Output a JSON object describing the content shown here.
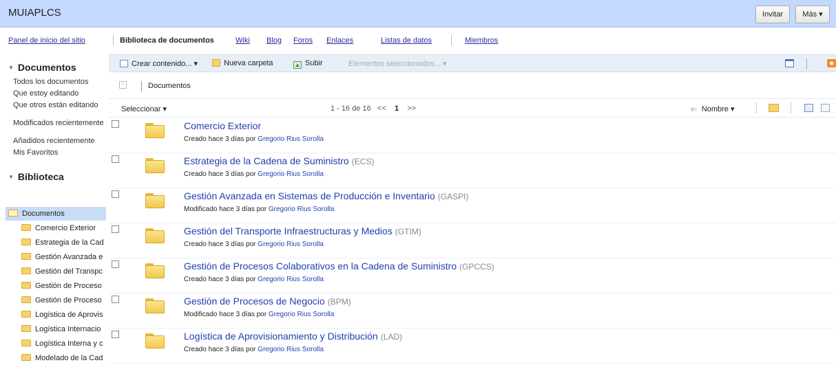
{
  "site": {
    "title": "MUIAPLCS",
    "invite_label": "Invitar",
    "more_label": "Más ▾"
  },
  "nav": {
    "home": "Panel de inicio del sitio",
    "active": "Biblioteca de documentos",
    "links": [
      "Wiki",
      "Blog",
      "Foros",
      "Enlaces",
      "Listas de datos"
    ],
    "members": "Miembros"
  },
  "sidebar": {
    "documents_heading": "Documentos",
    "document_links": [
      "Todos los documentos",
      "Que estoy editando",
      "Que otros están editando",
      "Modificados recientemente",
      "Añadidos recientemente",
      "Mis Favoritos"
    ],
    "library_heading": "Biblioteca",
    "tree_root": "Documentos",
    "tree_items": [
      "Comercio Exterior",
      "Estrategia de la Cad",
      "Gestión Avanzada e",
      "Gestión del Transpc",
      "Gestión de Proceso",
      "Gestión de Proceso",
      "Logística de Aprovis",
      "Logística Internacio",
      "Logística Interna y c",
      "Modelado de la Cad"
    ]
  },
  "toolbar": {
    "create": "Crear contenido... ▾",
    "new_folder": "Nueva carpeta",
    "upload": "Subir",
    "selected": "Elementos seleccionados... ▾"
  },
  "breadcrumb": {
    "current": "Documentos"
  },
  "list_header": {
    "select": "Seleccionar ▾",
    "range": "1 - 16 de 16",
    "prev": "<<",
    "page": "1",
    "next": ">>",
    "sort": "Nombre ▾"
  },
  "rows": [
    {
      "title": "Comercio Exterior",
      "abbr": "",
      "meta": "Creado hace 3 días por",
      "author": "Gregorio Rius Sorolla"
    },
    {
      "title": "Estrategia de la Cadena de Suministro",
      "abbr": "(ECS)",
      "meta": "Creado hace 3 días por",
      "author": "Gregorio Rius Sorolla"
    },
    {
      "title": "Gestión Avanzada en Sistemas de Producción e Inventario",
      "abbr": "(GASPI)",
      "meta": "Modificado hace 3 días por",
      "author": "Gregorio Rius Sorolla"
    },
    {
      "title": "Gestión del Transporte Infraestructuras y Medios",
      "abbr": "(GTIM)",
      "meta": "Creado hace 3 días por",
      "author": "Gregorio Rius Sorolla"
    },
    {
      "title": "Gestión de Procesos Colaborativos en la Cadena de Suministro",
      "abbr": "(GPCCS)",
      "meta": "Creado hace 3 días por",
      "author": "Gregorio Rius Sorolla"
    },
    {
      "title": "Gestión de Procesos de Negocio",
      "abbr": "(BPM)",
      "meta": "Modificado hace 3 días por",
      "author": "Gregorio Rius Sorolla"
    },
    {
      "title": "Logística de Aprovisionamiento y Distribución",
      "abbr": "(LAD)",
      "meta": "Creado hace 3 días por",
      "author": "Gregorio Rius Sorolla"
    }
  ],
  "icons": {
    "folder_color": "#f2c94c",
    "link_color": "#1f3fb0",
    "header_color": "#c3d9ff"
  }
}
